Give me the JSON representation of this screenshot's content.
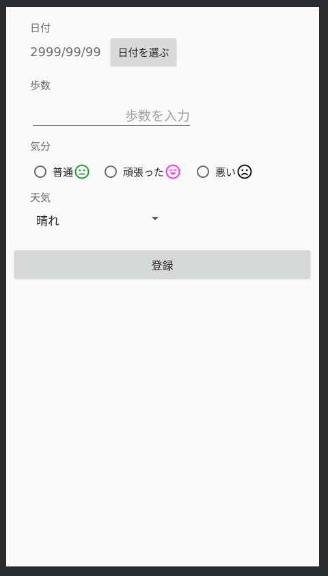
{
  "date": {
    "label": "日付",
    "value": "2999/99/99",
    "button_label": "日付を選ぶ"
  },
  "steps": {
    "label": "歩数",
    "placeholder": "歩数を入力"
  },
  "mood": {
    "label": "気分",
    "options": [
      {
        "label": "普通",
        "icon": "neutral-face-icon",
        "color": "#1a9b2d",
        "selected": false
      },
      {
        "label": "頑張った",
        "icon": "smiling-face-icon",
        "color": "#ff33ee",
        "selected": false
      },
      {
        "label": "悪い",
        "icon": "frowning-face-icon",
        "color": "#111111",
        "selected": false
      }
    ]
  },
  "weather": {
    "label": "天気",
    "selected": "晴れ"
  },
  "submit": {
    "label": "登録"
  }
}
